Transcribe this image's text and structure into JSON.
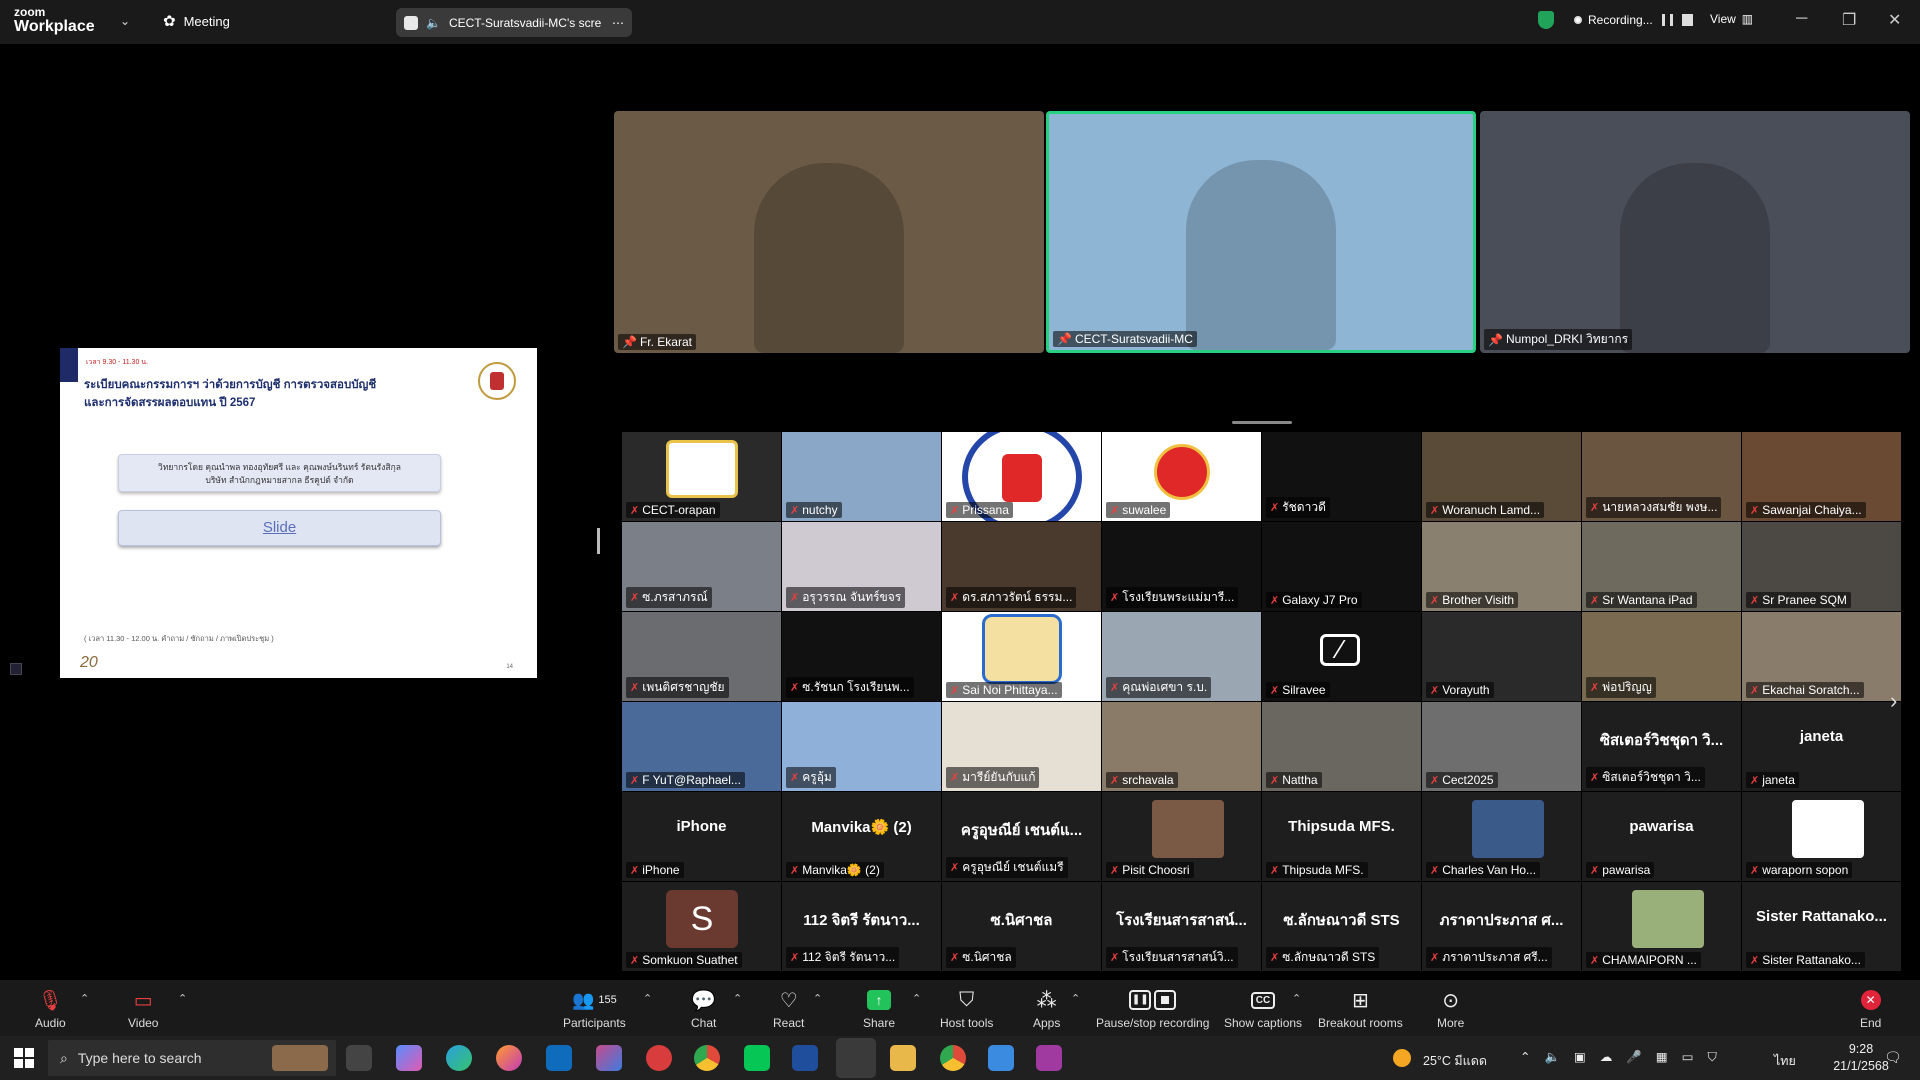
{
  "app": {
    "brand_line1": "zoom",
    "brand_line2": "Workplace",
    "meeting_label": "Meeting",
    "share_pill": "CECT-Suratsvadii-MC's scre",
    "recording_label": "Recording...",
    "view_label": "View"
  },
  "window": {
    "minimize": "─",
    "restore": "❐",
    "close": "✕"
  },
  "speakers": [
    {
      "name": "Fr. Ekarat",
      "bg": "#6b5a45"
    },
    {
      "name": "CECT-Suratsvadii-MC",
      "bg": "#8fb5d4",
      "active": true
    },
    {
      "name": "Numpol_DRKI วิทยากร",
      "bg": "#4a4e58"
    }
  ],
  "slide": {
    "time": "เวลา 9.30 - 11.30 น.",
    "title_line1": "ระเบียบคณะกรรมการฯ ว่าด้วยการบัญชี การตรวจสอบบัญชี",
    "title_line2": "และการจัดสรรผลตอบแทน ปี 2567",
    "speaker_line1": "วิทยากรโดย  คุณนำพล ทองอุทัยศรี  และ คุณพงษ์นรินทร์ รัตนรังสิกุล",
    "speaker_line2": "บริษัท สำนักกฎหมายสากล ธีรคูปต์ จำกัด",
    "link": "Slide",
    "footer": "( เวลา 11.30 - 12.00 น.  คำถาม / ซักถาม / ภาพเปิดประชุม )",
    "brand": "20",
    "page": "14"
  },
  "gallery": [
    [
      {
        "name": "CECT-orapan",
        "bg": "#2a2a2a",
        "kind": "logo"
      },
      {
        "name": "nutchy",
        "bg": "#8aa7c7"
      },
      {
        "name": "Prissana",
        "bg": "#ffffff",
        "kind": "logo2"
      },
      {
        "name": "suwalee",
        "bg": "#ffffff",
        "kind": "logo3"
      },
      {
        "name": "รัชดาวดี",
        "bg": "#111111"
      },
      {
        "name": "Woranuch Lamd...",
        "bg": "#5a4a38"
      },
      {
        "name": "นายหลวงสมชัย พงษ...",
        "bg": "#6a5640"
      },
      {
        "name": "Sawanjai Chaiya...",
        "bg": "#6b4a33"
      }
    ],
    [
      {
        "name": "ซ.ภรสาภรณ์",
        "bg": "#7a7f88"
      },
      {
        "name": "อรุวรรณ จันทร์ขจร",
        "bg": "#cfcad2"
      },
      {
        "name": "ดร.สภาวรัตน์ ธรรม...",
        "bg": "#4a3a2e"
      },
      {
        "name": "โรงเรียนพระแม่มารี...",
        "bg": "#111111"
      },
      {
        "name": "Galaxy J7 Pro",
        "bg": "#111111"
      },
      {
        "name": "Brother Visith",
        "bg": "#8a8070"
      },
      {
        "name": "Sr Wantana iPad",
        "bg": "#6f6a5e"
      },
      {
        "name": "Sr Pranee SQM",
        "bg": "#4c4844"
      }
    ],
    [
      {
        "name": "เพนติศรชาญชัย",
        "bg": "#6a6c70"
      },
      {
        "name": "ซ.รัชนก โรงเรียนพ...",
        "bg": "#111111"
      },
      {
        "name": "Sai Noi Phittaya...",
        "bg": "#ffffff",
        "kind": "logo4"
      },
      {
        "name": "คุณพ่อเศขา ร.บ.",
        "bg": "#9aa6b2"
      },
      {
        "name": "Silravee",
        "bg": "#111111",
        "kind": "camoff"
      },
      {
        "name": "Vorayuth",
        "bg": "#2a2a2a"
      },
      {
        "name": "พ่อปริญญ",
        "bg": "#7a6a50"
      },
      {
        "name": "Ekachai Soratch...",
        "bg": "#8a7c6a"
      }
    ],
    [
      {
        "name": "F YuT@Raphael...",
        "bg": "#4a6a9a"
      },
      {
        "name": "ครูอุ้ม",
        "bg": "#8fb0d8"
      },
      {
        "name": "มารีย์ยันกับแก้",
        "bg": "#e6e0d4"
      },
      {
        "name": "srchavala",
        "bg": "#8a7a68"
      },
      {
        "name": "Nattha",
        "bg": "#6a6660"
      },
      {
        "name": "Cect2025",
        "bg": "#6e6e6e"
      },
      {
        "name": "ซิสเตอร์วิชชุดา วิ...",
        "bg": "#1e1e1e",
        "big": "ซิสเตอร์วิชชุดา วิ..."
      },
      {
        "name": "janeta",
        "bg": "#1e1e1e",
        "big": "janeta"
      }
    ],
    [
      {
        "name": "iPhone",
        "bg": "#1e1e1e",
        "big": "iPhone"
      },
      {
        "name": "Manvika🌼 (2)",
        "bg": "#1e1e1e",
        "big": "Manvika🌼 (2)"
      },
      {
        "name": "ครูอุษณีย์ เชนต์แมรี",
        "bg": "#1e1e1e",
        "big": "ครูอุษณีย์ เชนต์แ..."
      },
      {
        "name": "Pisit Choosri",
        "bg": "#1e1e1e",
        "kind": "avatar",
        "av": "#7a5a44"
      },
      {
        "name": "Thipsuda MFS.",
        "bg": "#1e1e1e",
        "big": "Thipsuda MFS."
      },
      {
        "name": "Charles Van Ho...",
        "bg": "#1e1e1e",
        "kind": "avatar",
        "av": "#3a5a8a"
      },
      {
        "name": "pawarisa",
        "bg": "#1e1e1e",
        "big": "pawarisa"
      },
      {
        "name": "waraporn sopon",
        "bg": "#1e1e1e",
        "kind": "avatar",
        "av": "#ffffff"
      }
    ],
    [
      {
        "name": "Somkuon Suathet",
        "bg": "#1e1e1e",
        "kind": "letter",
        "letter": "S"
      },
      {
        "name": "112 จิตรี รัตนาว...",
        "bg": "#1e1e1e",
        "big": "112 จิตรี รัตนาว..."
      },
      {
        "name": "ซ.นิศาชล",
        "bg": "#1e1e1e",
        "big": "ซ.นิศาชล"
      },
      {
        "name": "โรงเรียนสารสาสน์วิ...",
        "bg": "#1e1e1e",
        "big": "โรงเรียนสารสาสน์..."
      },
      {
        "name": "ซ.ลักษณาวดี STS",
        "bg": "#1e1e1e",
        "big": "ซ.ลักษณาวดี STS"
      },
      {
        "name": "ภราดาประภาส ศรี...",
        "bg": "#1e1e1e",
        "big": "ภราดาประภาส ศ..."
      },
      {
        "name": "CHAMAIPORN ...",
        "bg": "#1e1e1e",
        "kind": "avatar",
        "av": "#9ab07a"
      },
      {
        "name": "Sister Rattanako...",
        "bg": "#1e1e1e",
        "big": "Sister Rattanako..."
      }
    ]
  ],
  "toolbar": {
    "audio": "Audio",
    "video": "Video",
    "participants": "Participants",
    "participants_count": "155",
    "chat": "Chat",
    "react": "React",
    "share": "Share",
    "host_tools": "Host tools",
    "apps": "Apps",
    "pause_rec": "Pause/stop recording",
    "captions": "Show captions",
    "breakout": "Breakout rooms",
    "more": "More",
    "end": "End"
  },
  "taskbar": {
    "search_placeholder": "Type here to search",
    "temp": "25°C มีแดด",
    "lang": "ไทย",
    "time": "9:28",
    "date": "21/1/2568"
  },
  "colors": {
    "active_border": "#27d17f",
    "share_green": "#22c35a",
    "end_red": "#e0243a"
  }
}
